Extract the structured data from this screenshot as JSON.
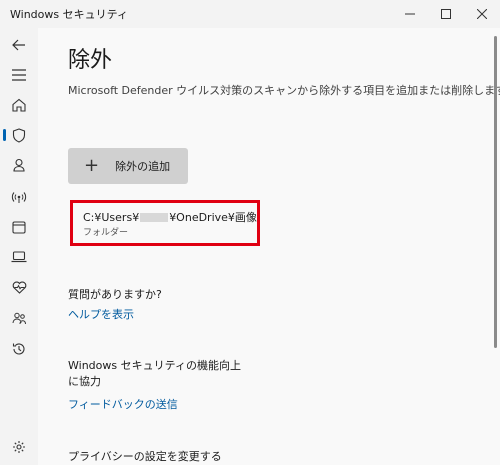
{
  "window": {
    "title": "Windows セキュリティ"
  },
  "sidebar": {
    "items": [
      {
        "name": "back-icon"
      },
      {
        "name": "menu-icon"
      },
      {
        "name": "home-icon"
      },
      {
        "name": "shield-icon",
        "active": true
      },
      {
        "name": "account-icon"
      },
      {
        "name": "network-icon"
      },
      {
        "name": "app-browser-icon"
      },
      {
        "name": "device-security-icon"
      },
      {
        "name": "health-icon"
      },
      {
        "name": "family-icon"
      },
      {
        "name": "history-icon"
      },
      {
        "name": "settings-icon"
      }
    ]
  },
  "page": {
    "title": "除外",
    "description": "Microsoft Defender ウイルス対策のスキャンから除外する項目を追加または削除します。",
    "add_button": "除外の追加"
  },
  "exclusion": {
    "path_prefix": "C:¥Users¥",
    "path_suffix": "¥OneDrive¥画像",
    "type": "フォルダー"
  },
  "help": {
    "title": "質問がありますか?",
    "link": "ヘルプを表示"
  },
  "improve": {
    "title": "Windows セキュリティの機能向上に協力",
    "link": "フィードバックの送信"
  },
  "privacy": {
    "title": "プライバシーの設定を変更する"
  },
  "colors": {
    "accent": "#0063b1",
    "link": "#005a9e",
    "highlight_border": "#e00012"
  }
}
